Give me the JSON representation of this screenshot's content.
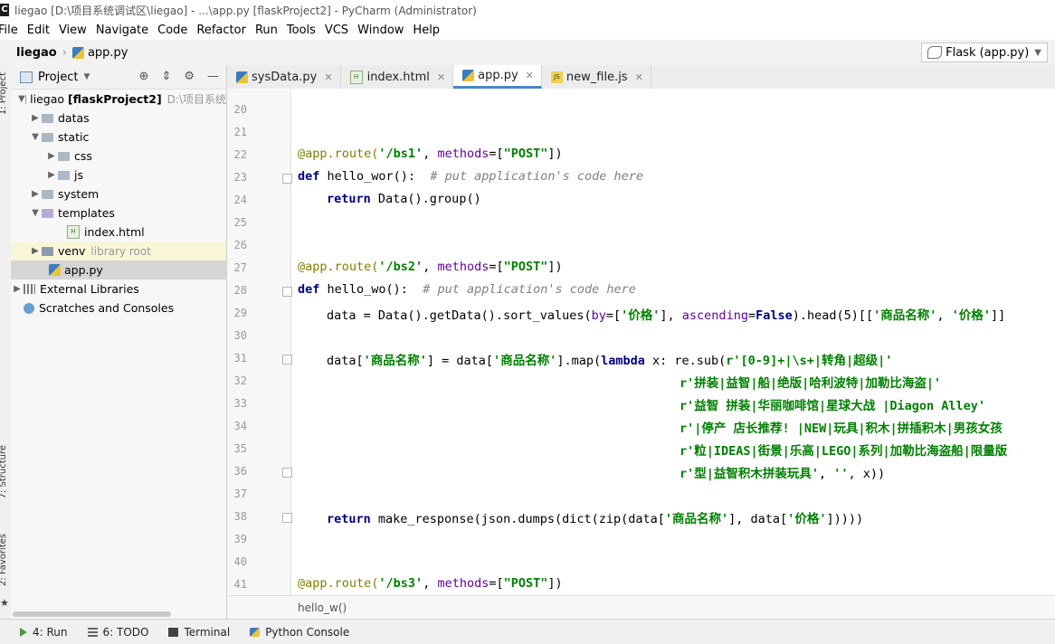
{
  "window": {
    "title": "liegao [D:\\项目系统调试区\\liegao] - ...\\app.py [flaskProject2] - PyCharm (Administrator)"
  },
  "menu": [
    "File",
    "Edit",
    "View",
    "Navigate",
    "Code",
    "Refactor",
    "Run",
    "Tools",
    "VCS",
    "Window",
    "Help"
  ],
  "navbar": {
    "project": "liegao",
    "file": "app.py",
    "run_config": "Flask (app.py)"
  },
  "side_tabs": {
    "project": "1: Project",
    "structure": "7: Structure",
    "favorites": "2: Favorites"
  },
  "project_panel": {
    "title": "Project",
    "tree": [
      {
        "label": "liegao",
        "extra": "[flaskProject2]",
        "path": "D:\\项目系统"
      },
      {
        "label": "datas"
      },
      {
        "label": "static"
      },
      {
        "label": "css"
      },
      {
        "label": "js"
      },
      {
        "label": "system"
      },
      {
        "label": "templates"
      },
      {
        "label": "index.html"
      },
      {
        "label": "venv",
        "note": "library root"
      },
      {
        "label": "app.py"
      },
      {
        "label": "External Libraries"
      },
      {
        "label": "Scratches and Consoles"
      }
    ]
  },
  "tabs": [
    {
      "label": "sysData.py"
    },
    {
      "label": "index.html"
    },
    {
      "label": "app.py"
    },
    {
      "label": "new_file.js"
    }
  ],
  "editor": {
    "line_numbers": [
      "20",
      "21",
      "22",
      "23",
      "24",
      "25",
      "26",
      "27",
      "28",
      "29",
      "30",
      "31",
      "32",
      "33",
      "34",
      "35",
      "36",
      "37",
      "38",
      "39",
      "40",
      "41"
    ],
    "lines": {
      "l22": {
        "dec": "@app.route(",
        "s1": "'/bs1'",
        "p1": ", ",
        "kwa": "methods",
        "p2": "=[",
        "s2": "\"POST\"",
        "p3": "])"
      },
      "l23": {
        "kw": "def",
        "name": " hello_wor():  ",
        "cm": "# put application's code here"
      },
      "l24": {
        "kw": "return",
        "rest": " Data().group()"
      },
      "l27": {
        "dec": "@app.route(",
        "s1": "'/bs2'",
        "p1": ", ",
        "kwa": "methods",
        "p2": "=[",
        "s2": "\"POST\"",
        "p3": "])"
      },
      "l28": {
        "kw": "def",
        "name": " hello_wo():  ",
        "cm": "# put application's code here"
      },
      "l29": {
        "a": "data = Data().getData().sort_values(",
        "kwa1": "by",
        "b": "=[",
        "s1": "'价格'",
        "c": "], ",
        "kwa2": "ascending",
        "d": "=",
        "kw": "False",
        "e": ").head(5)[[",
        "s2": "'商品名称'",
        "f": ", ",
        "s3": "'价格'",
        "g": "]]"
      },
      "l31": {
        "a": "data[",
        "s1": "'商品名称'",
        "b": "] = data[",
        "s2": "'商品名称'",
        "c": "].map(",
        "kw": "lambda",
        "d": " x: re.sub(",
        "s3": "r'[0-9]+|\\s+|转角|超级|'"
      },
      "l32": {
        "s": "r'拼装|益智|船|绝版|哈利波特|加勒比海盗|'"
      },
      "l33": {
        "s": "r'益智 拼装|华丽咖啡馆|星球大战 |Diagon Alley'"
      },
      "l34": {
        "s": "r'|停产 店长推荐! |NEW|玩具|积木|拼插积木|男孩女孩"
      },
      "l35": {
        "s": "r'粒|IDEAS|街景|乐高|LEGO|系列|加勒比海盗船|限量版"
      },
      "l36": {
        "s": "r'型|益智积木拼装玩具'",
        "a": ", ",
        "s2": "''",
        "b": ", x))"
      },
      "l38": {
        "kw": "return",
        "a": " make_response(json.dumps(dict(zip(data[",
        "s1": "'商品名称'",
        "b": "], data[",
        "s2": "'价格'",
        "c": "]))))"
      },
      "l41": {
        "dec": "@app.route(",
        "s1": "'/bs3'",
        "p1": ", ",
        "kwa": "methods",
        "p2": "=[",
        "s2": "\"POST\"",
        "p3": "])"
      }
    },
    "breadcrumb": "hello_w()"
  },
  "bottom_bar": {
    "run": "4: Run",
    "todo": "6: TODO",
    "terminal": "Terminal",
    "python_console": "Python Console"
  }
}
